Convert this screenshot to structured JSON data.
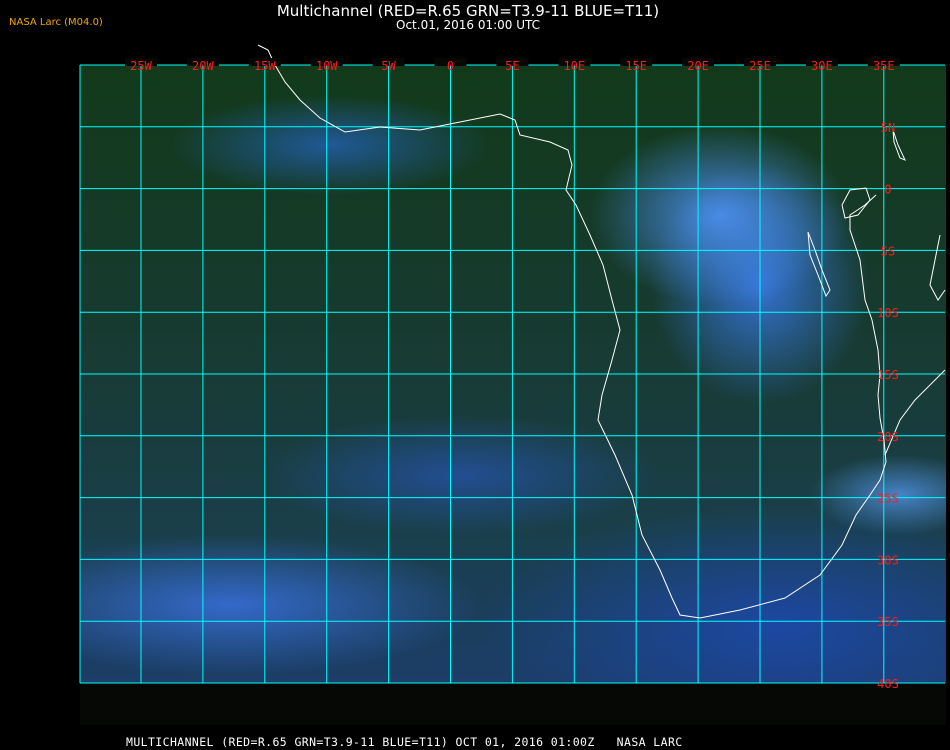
{
  "credit": "NASA Larc (M04.0)",
  "title": "Multichannel (RED=R.65 GRN=T3.9-11 BLUE=T11)",
  "subtitle": "Oct.01, 2016 01:00 UTC",
  "footer": "MULTICHANNEL (RED=R.65 GRN=T3.9-11 BLUE=T11) OCT 01, 2016 01:00Z   NASA LARC",
  "map": {
    "grid_color": "#00ffff",
    "label_color": "#ff0000",
    "coastline_color": "#ffffff",
    "longitude_labels": [
      "25W",
      "20W",
      "15W",
      "10W",
      "5W",
      "0",
      "5E",
      "10E",
      "15E",
      "20E",
      "25E",
      "30E",
      "35E"
    ],
    "latitude_labels": [
      "5N",
      "0",
      "5S",
      "10S",
      "15S",
      "20S",
      "25S",
      "30S",
      "35S",
      "40S"
    ]
  }
}
